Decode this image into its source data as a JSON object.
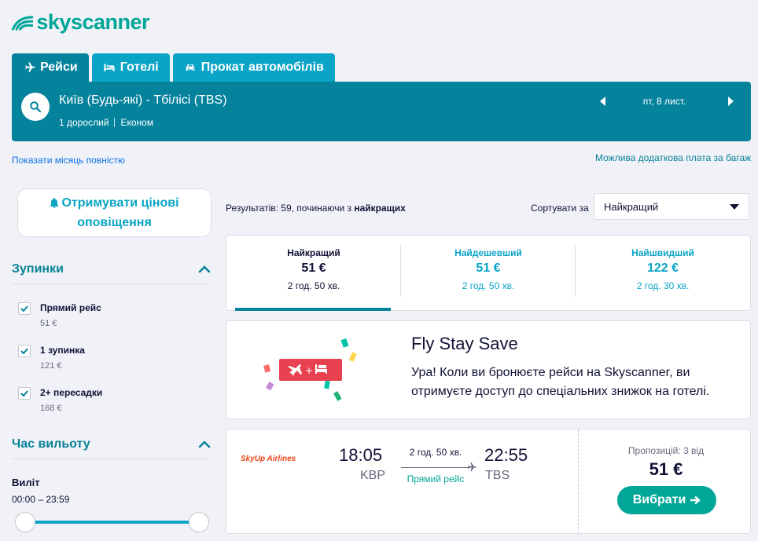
{
  "brand": {
    "name": "skyscanner",
    "color": "#00a698"
  },
  "tabs": [
    {
      "label": "Рейси",
      "icon": "plane-icon",
      "active": true
    },
    {
      "label": "Готелі",
      "icon": "bed-icon",
      "active": false
    },
    {
      "label": "Прокат автомобілів",
      "icon": "car-icon",
      "active": false
    }
  ],
  "search": {
    "route": "Київ (Будь-які) - Тбілісі (TBS)",
    "passengers": "1 дорослий",
    "cabin": "Економ",
    "date": "пт, 8 лист."
  },
  "links": {
    "show_month": "Показати місяць повністю",
    "baggage": "Можлива додаткова плата за багаж"
  },
  "alerts": {
    "line1": "Отримувати цінові",
    "line2": "оповіщення"
  },
  "filters": {
    "stops": {
      "title": "Зупинки",
      "items": [
        {
          "label": "Прямий рейс",
          "price": "51 €",
          "checked": true
        },
        {
          "label": "1 зупинка",
          "price": "121 €",
          "checked": true
        },
        {
          "label": "2+ пересадки",
          "price": "168 €",
          "checked": true
        }
      ]
    },
    "departure": {
      "title": "Час вильоту",
      "sub": "Виліт",
      "range": "00:00 – 23:59"
    }
  },
  "results": {
    "summary_prefix": "Результатів: 59, починаючи з ",
    "summary_bold": "найкращих",
    "sort_label": "Сортувати за",
    "sort_value": "Найкращий"
  },
  "sort_tabs": [
    {
      "title": "Найкращий",
      "price": "51 €",
      "duration": "2 год. 50 хв."
    },
    {
      "title": "Найдешевший",
      "price": "51 €",
      "duration": "2 год. 50 хв."
    },
    {
      "title": "Найшвидший",
      "price": "122 €",
      "duration": "2 год. 30 хв."
    }
  ],
  "promo": {
    "title": "Fly Stay Save",
    "text": "Ура! Коли ви бронюєте рейси на Skyscanner, ви отримуєте доступ до спеціальних знижок на готелі."
  },
  "flight": {
    "airline": "SkyUp Airlines",
    "dep_time": "18:05",
    "dep_code": "KBP",
    "arr_time": "22:55",
    "arr_code": "TBS",
    "duration": "2 год. 50 хв.",
    "stops": "Прямий рейс",
    "offers": "Пропозицій: 3 від",
    "price": "51 €",
    "select": "Вибрати"
  }
}
